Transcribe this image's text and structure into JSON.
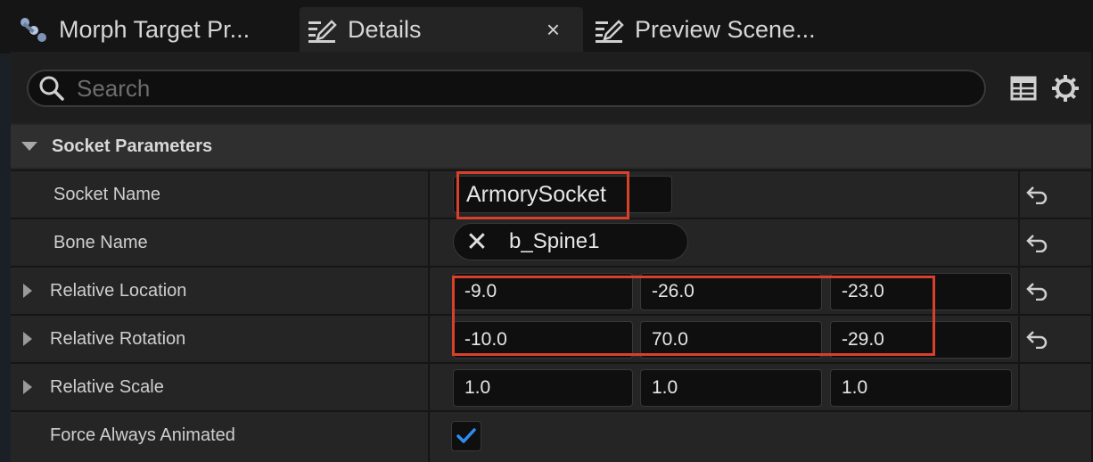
{
  "tabs": [
    {
      "label": "Morph Target Pr...",
      "icon": "morph-target-icon",
      "active": false
    },
    {
      "label": "Details",
      "icon": "details-pencil-icon",
      "active": true,
      "close": "×"
    },
    {
      "label": "Preview Scene...",
      "icon": "details-pencil-icon",
      "active": false
    }
  ],
  "search": {
    "placeholder": "Search"
  },
  "toolbar": {
    "table_icon": "table-view-icon",
    "settings_icon": "gear-icon"
  },
  "category": {
    "label": "Socket Parameters"
  },
  "properties": {
    "socket_name": {
      "label": "Socket Name",
      "value": "ArmorySocket"
    },
    "bone_name": {
      "label": "Bone Name",
      "value": "b_Spine1",
      "clear_glyph": "✕"
    },
    "relative_location": {
      "label": "Relative Location",
      "x": "-9.0",
      "y": "-26.0",
      "z": "-23.0"
    },
    "relative_rotation": {
      "label": "Relative Rotation",
      "x": "-10.0",
      "y": "70.0",
      "z": "-29.0"
    },
    "relative_scale": {
      "label": "Relative Scale",
      "x": "1.0",
      "y": "1.0",
      "z": "1.0"
    },
    "force_always_animated": {
      "label": "Force Always Animated",
      "checked": true
    }
  },
  "colors": {
    "highlight": "#d8402a",
    "check": "#2d8ef0"
  }
}
